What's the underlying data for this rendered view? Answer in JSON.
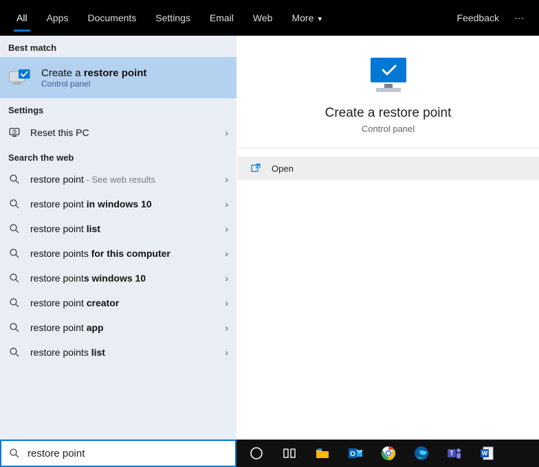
{
  "topbar": {
    "tabs": [
      "All",
      "Apps",
      "Documents",
      "Settings",
      "Email",
      "Web",
      "More"
    ],
    "feedback": "Feedback"
  },
  "sections": {
    "best_match": "Best match",
    "settings": "Settings",
    "search_web": "Search the web"
  },
  "best_match": {
    "title_prefix": "Create a ",
    "title_bold": "restore point",
    "subtitle": "Control panel"
  },
  "settings_items": [
    {
      "label": "Reset this PC"
    }
  ],
  "web_results": [
    {
      "plain": "restore point",
      "bold": "",
      "hint": " - See web results"
    },
    {
      "plain": "restore point ",
      "bold": "in windows 10",
      "hint": ""
    },
    {
      "plain": "restore point ",
      "bold": "list",
      "hint": ""
    },
    {
      "plain": "restore points ",
      "bold": "for this computer",
      "hint": ""
    },
    {
      "plain": "restore point",
      "bold": "s windows 10",
      "hint": ""
    },
    {
      "plain": "restore point ",
      "bold": "creator",
      "hint": ""
    },
    {
      "plain": "restore point ",
      "bold": "app",
      "hint": ""
    },
    {
      "plain": "restore points ",
      "bold": "list",
      "hint": ""
    }
  ],
  "preview": {
    "title": "Create a restore point",
    "subtitle": "Control panel",
    "action": "Open"
  },
  "search": {
    "value": "restore point"
  }
}
